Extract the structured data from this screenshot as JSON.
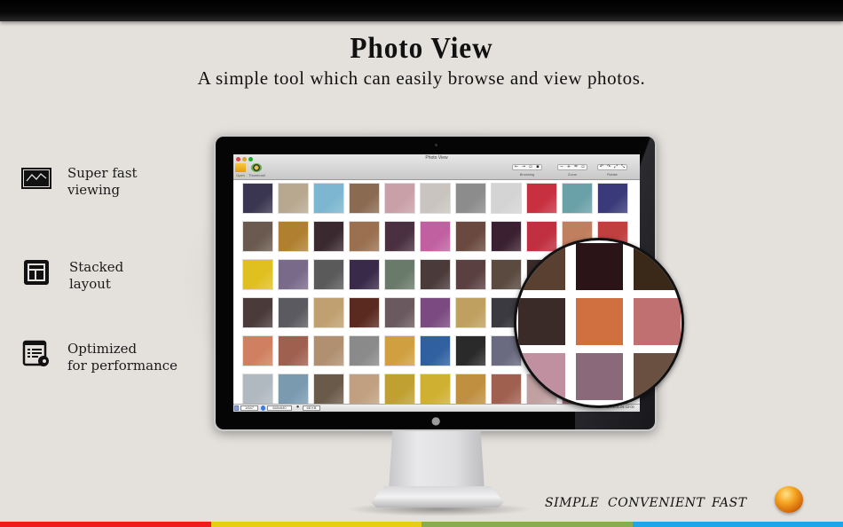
{
  "header": {
    "title": "Photo View",
    "subtitle": "A simple tool which can easily browse and view photos."
  },
  "features": [
    {
      "icon": "landscape-photo-icon",
      "line1": "Super fast",
      "line2": "viewing"
    },
    {
      "icon": "stacked-layout-icon",
      "line1": "Stacked",
      "line2": "layout"
    },
    {
      "icon": "performance-list-icon",
      "line1": "Optimized",
      "line2": "for performance"
    }
  ],
  "app_window": {
    "title": "Photo View",
    "toolbar": {
      "open_label": "Open",
      "thumbnail_label": "Thumbnail",
      "groups": [
        {
          "label": "Browsing",
          "buttons": [
            "←",
            "→",
            "▫",
            "▪"
          ]
        },
        {
          "label": "Zoom",
          "buttons": [
            "−",
            "+",
            "=",
            "▫"
          ]
        },
        {
          "label": "Rotate",
          "buttons": [
            "↶",
            "↷",
            "⤢",
            "⤡"
          ]
        }
      ]
    },
    "thumbnails": {
      "rows": 6,
      "columns": 11,
      "colors": [
        [
          "#3a3550",
          "#b8a890",
          "#7cb6d0",
          "#8a6a50",
          "#caa0a8",
          "#c9c4bf",
          "#8c8c8c",
          "#d4d4d4",
          "#c83040",
          "#6aa0a8",
          "#3a3a7a"
        ],
        [
          "#6a5a50",
          "#b08030",
          "#3a2a30",
          "#9a7050",
          "#4a3040",
          "#c060a0",
          "#6a4a40",
          "#3a2030",
          "#c03040",
          "#c08060",
          "#c04040"
        ],
        [
          "#e0c020",
          "#7a6a8a",
          "#5a5a5a",
          "#3a2a4a",
          "#6a7a6a",
          "#4a3a3a",
          "#5a4040",
          "#5a4a40",
          "#3a2a2a",
          "#2a1a1a",
          "#3a2a20"
        ],
        [
          "#4a3a3a",
          "#5a5a60",
          "#c0a070",
          "#5a2a20",
          "#6a5a60",
          "#7a4a80",
          "#c0a060",
          "#3a3a40",
          "#4a3a2a",
          "#c0b0b0",
          "#5a4a4a"
        ],
        [
          "#d08060",
          "#a06050",
          "#b09070",
          "#8a8a8a",
          "#d0a040",
          "#3060a0",
          "#2a2a2a",
          "#6a6a80",
          "#a07060",
          "#7a5a6a",
          "#b0a0a0"
        ],
        [
          "#b0b8c0",
          "#7a9ab0",
          "#6a5a4a",
          "#c0a080",
          "#c0a030",
          "#d0b030",
          "#c09040",
          "#a06050",
          "#c0a0a0",
          "#b07080",
          "#8a6a60"
        ]
      ]
    },
    "magnifier_colors": [
      [
        "#5a4030",
        "#2a1418",
        "#3a2818"
      ],
      [
        "#3a2a28",
        "#d07040",
        "#c07070"
      ],
      [
        "#c090a0",
        "#8a6a7a",
        "#6a5040"
      ]
    ],
    "statusbar": {
      "fields": [
        "1/647",
        "640x640",
        "68 KB"
      ],
      "right_text": "2013-01-01 12:00"
    }
  },
  "taglines": [
    "SIMPLE",
    "CONVENIENT",
    "FAST"
  ],
  "color_bar": [
    "#ee1c1c",
    "#e6cf12",
    "#8aab50",
    "#1aa8e8"
  ]
}
